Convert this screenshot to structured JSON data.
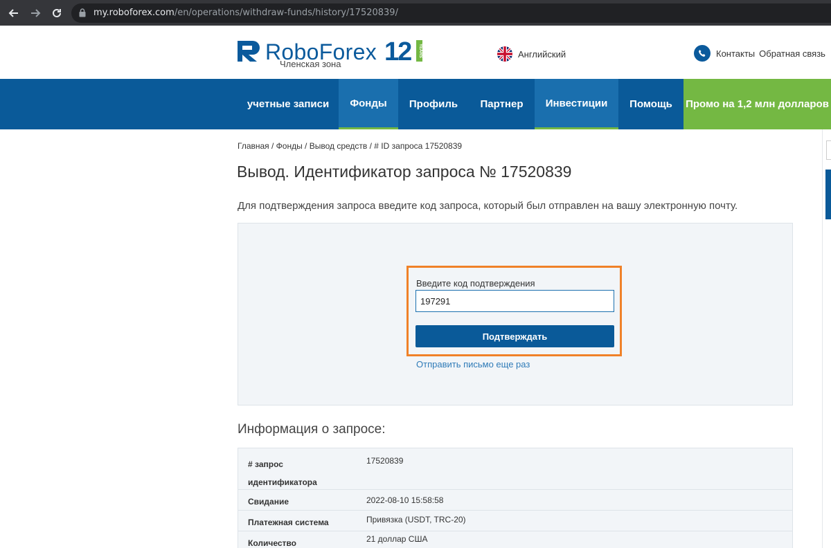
{
  "browser": {
    "url_domain": "my.roboforex.com",
    "url_path": "/en/operations/withdraw-funds/history/17520839/"
  },
  "header": {
    "logo_text": "RoboForex",
    "logo_subtitle": "Членская зона",
    "logo_badge_number": "12",
    "logo_badge_years": "YEARS",
    "language_label": "Английский",
    "contacts_label": "Контакты",
    "feedback_label": "Обратная связь"
  },
  "nav": {
    "items": [
      {
        "label": "учетные записи"
      },
      {
        "label": "Фонды"
      },
      {
        "label": "Профиль"
      },
      {
        "label": "Партнер"
      },
      {
        "label": "Инвестиции"
      },
      {
        "label": "Помощь"
      },
      {
        "label": "Промо на 1,2 млн долларов"
      }
    ]
  },
  "main": {
    "breadcrumb": "Главная / Фонды / Вывод средств / # ID запроса 17520839",
    "title": "Вывод. Идентификатор запроса № 17520839",
    "intro": "Для подтверждения запроса введите код запроса, который был отправлен на вашу электронную почту.",
    "form": {
      "code_label": "Введите код подтверждения",
      "code_value": "197291",
      "submit_label": "Подтверждать",
      "resend_label": "Отправить письмо еще раз"
    },
    "info_title": "Информация о запросе:",
    "info_rows": [
      {
        "key_line1": "# запрос",
        "key_line2": "идентификатора",
        "value": "17520839"
      },
      {
        "key": "Свидание",
        "value": "2022-08-10 15:58:58"
      },
      {
        "key": "Платежная система",
        "value": "Привязка (USDT, TRC-20)"
      },
      {
        "key": "Количество",
        "value": "21 доллар США"
      }
    ]
  },
  "colors": {
    "brand_blue": "#0a5a99",
    "accent_green": "#74b843",
    "highlight_orange": "#f08128"
  }
}
